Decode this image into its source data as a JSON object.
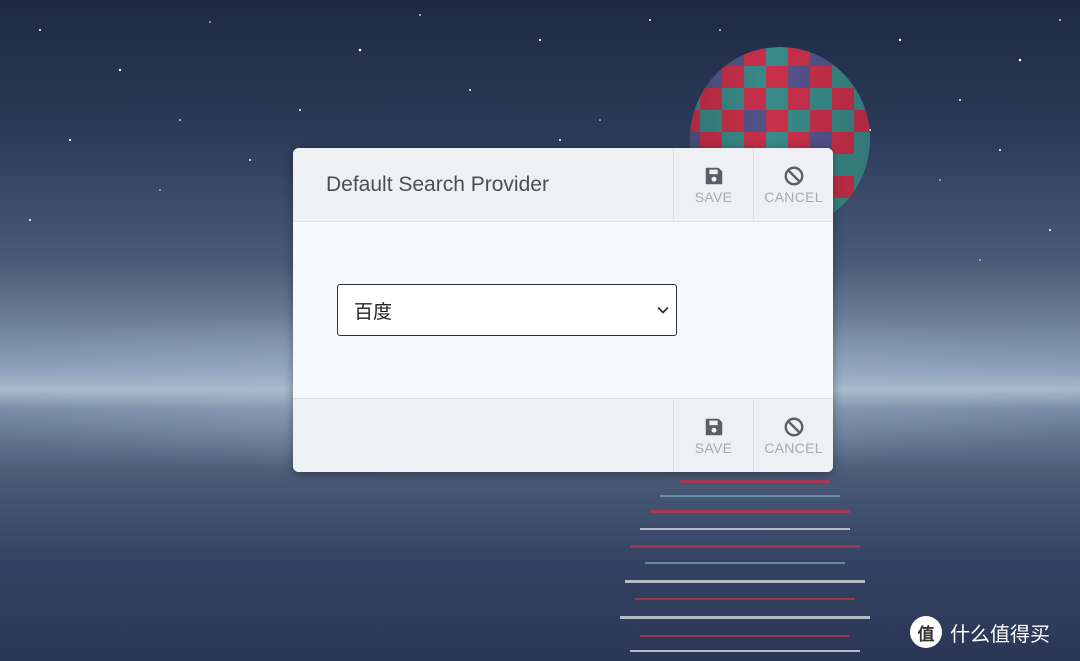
{
  "dialog": {
    "title": "Default Search Provider",
    "header_actions": {
      "save_label": "SAVE",
      "cancel_label": "CANCEL"
    },
    "footer_actions": {
      "save_label": "SAVE",
      "cancel_label": "CANCEL"
    },
    "provider_select": {
      "selected_value": "百度"
    }
  },
  "watermark": {
    "logo_char": "值",
    "text": "什么值得买"
  },
  "colors": {
    "dialog_bg": "#f6f7fb",
    "header_bg": "#eef0f4",
    "title_text": "#4a4f57",
    "action_icon": "#5a5e66",
    "action_label": "#a7abb2"
  },
  "icons": {
    "save": "floppy-disk-icon",
    "cancel": "ban-icon",
    "dropdown": "chevron-down-icon"
  }
}
